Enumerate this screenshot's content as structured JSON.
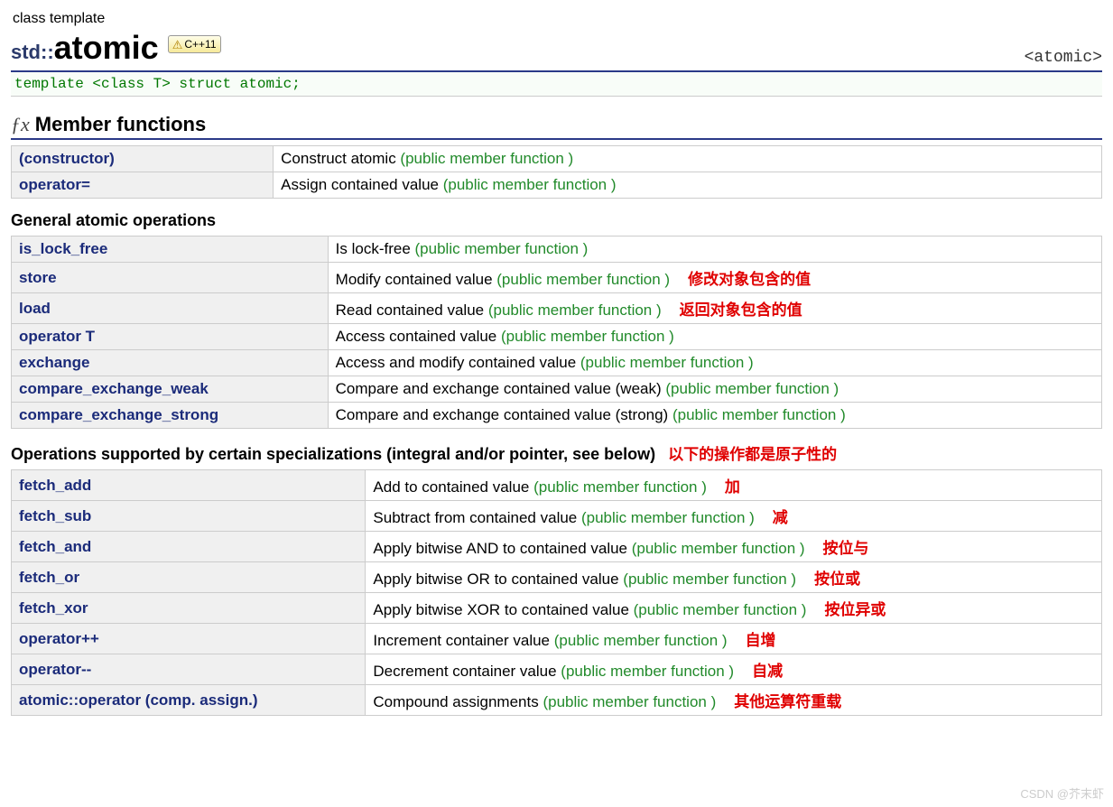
{
  "header": {
    "label": "class template",
    "namespace": "std::",
    "classname": "atomic",
    "badge_text": "C++11",
    "header_file": "<atomic>"
  },
  "template_decl": "template <class T> struct atomic;",
  "section_title": "Member functions",
  "tag_text": "(public member function )",
  "tables": {
    "basic": [
      {
        "name": "(constructor)",
        "desc": "Construct atomic",
        "note": ""
      },
      {
        "name": "operator=",
        "desc": "Assign contained value",
        "note": ""
      }
    ],
    "general_title": "General atomic operations",
    "general": [
      {
        "name": "is_lock_free",
        "desc": "Is lock-free",
        "note": ""
      },
      {
        "name": "store",
        "desc": "Modify contained value",
        "note": "修改对象包含的值"
      },
      {
        "name": "load",
        "desc": "Read contained value",
        "note": "返回对象包含的值"
      },
      {
        "name": "operator T",
        "desc": "Access contained value",
        "note": ""
      },
      {
        "name": "exchange",
        "desc": "Access and modify contained value",
        "note": ""
      },
      {
        "name": "compare_exchange_weak",
        "desc": "Compare and exchange contained value (weak)",
        "note": ""
      },
      {
        "name": "compare_exchange_strong",
        "desc": "Compare and exchange contained value (strong)",
        "note": ""
      }
    ],
    "ops_title": "Operations supported by certain specializations (integral and/or pointer, see below)",
    "ops_note": "以下的操作都是原子性的",
    "ops": [
      {
        "name": "fetch_add",
        "desc": "Add to contained value",
        "note": "加"
      },
      {
        "name": "fetch_sub",
        "desc": "Subtract from contained value",
        "note": "减"
      },
      {
        "name": "fetch_and",
        "desc": "Apply bitwise AND to contained value",
        "note": "按位与"
      },
      {
        "name": "fetch_or",
        "desc": "Apply bitwise OR to contained value",
        "note": "按位或"
      },
      {
        "name": "fetch_xor",
        "desc": "Apply bitwise XOR to contained value",
        "note": "按位异或"
      },
      {
        "name": "operator++",
        "desc": "Increment container value",
        "note": "自增"
      },
      {
        "name": "operator--",
        "desc": "Decrement container value",
        "note": "自减"
      },
      {
        "name": "atomic::operator (comp. assign.)",
        "desc": "Compound assignments",
        "note": "其他运算符重载"
      }
    ]
  },
  "watermark": "CSDN @芥末虾"
}
